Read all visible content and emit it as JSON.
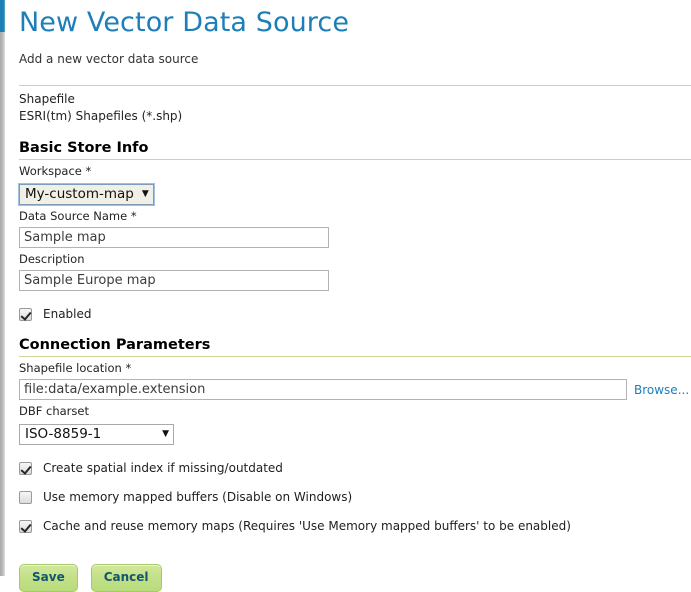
{
  "page": {
    "title": "New Vector Data Source",
    "subtitle": "Add a new vector data source"
  },
  "store_type": {
    "name": "Shapefile",
    "description": "ESRI(tm) Shapefiles (*.shp)"
  },
  "basic_store_info": {
    "heading": "Basic Store Info",
    "workspace": {
      "label": "Workspace *",
      "value": "My-custom-map",
      "arrow": "▼"
    },
    "data_source_name": {
      "label": "Data Source Name *",
      "value": "Sample map"
    },
    "description": {
      "label": "Description",
      "value": "Sample Europe map"
    },
    "enabled": {
      "label": "Enabled",
      "checked": true
    }
  },
  "connection_parameters": {
    "heading": "Connection Parameters",
    "shapefile_location": {
      "label": "Shapefile location *",
      "value": "file:data/example.extension",
      "browse_label": "Browse..."
    },
    "dbf_charset": {
      "label": "DBF charset",
      "value": "ISO-8859-1",
      "arrow": "▼"
    },
    "options": [
      {
        "label": "Create spatial index if missing/outdated",
        "checked": true
      },
      {
        "label": "Use memory mapped buffers (Disable on Windows)",
        "checked": false
      },
      {
        "label": "Cache and reuse memory maps (Requires 'Use Memory mapped buffers' to be enabled)",
        "checked": true
      }
    ]
  },
  "actions": {
    "save_label": "Save",
    "cancel_label": "Cancel"
  },
  "colors": {
    "title_blue": "#1c7fb8",
    "rule_olive": "#c8d79a",
    "button_green": "#c3e088",
    "button_text": "#12556f",
    "link_blue": "#1c7fb8",
    "edge_blue": "#1b80b6"
  }
}
